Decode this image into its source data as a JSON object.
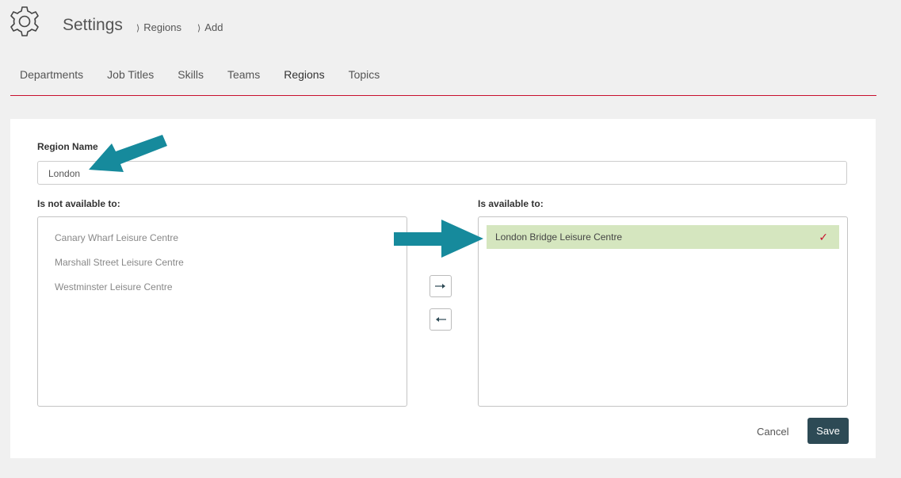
{
  "header": {
    "title": "Settings",
    "breadcrumbs": [
      "Regions",
      "Add"
    ],
    "breadcrumb_separator": "⟩"
  },
  "tabs": [
    {
      "label": "Departments"
    },
    {
      "label": "Job Titles"
    },
    {
      "label": "Skills"
    },
    {
      "label": "Teams"
    },
    {
      "label": "Regions",
      "active": true
    },
    {
      "label": "Topics"
    }
  ],
  "form": {
    "region_name_label": "Region Name",
    "region_name_value": "London",
    "not_available_label": "Is not available to:",
    "available_label": "Is available to:",
    "not_available_items": [
      "Canary Wharf Leisure Centre",
      "Marshall Street Leisure Centre",
      "Westminster Leisure Centre"
    ],
    "available_items": [
      "London Bridge Leisure Centre"
    ],
    "check_mark": "✓",
    "cancel_label": "Cancel",
    "save_label": "Save"
  },
  "colors": {
    "accent": "#c8102e",
    "selected_bg": "#d5e6bf",
    "save_bg": "#2d4a55",
    "annotation_arrow": "#168a9c"
  },
  "icons": {
    "settings": "gear-icon",
    "move_right": "arrow-right-icon",
    "move_left": "arrow-left-icon",
    "annotation": "annotation-arrow-icon"
  }
}
